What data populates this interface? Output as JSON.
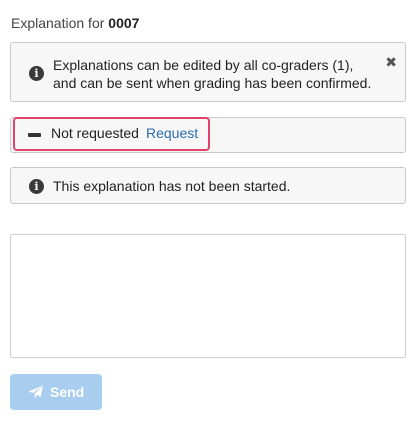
{
  "header": {
    "prefix": "Explanation for",
    "id": "0007"
  },
  "edit_notice": {
    "text": "Explanations can be edited by all co-graders (1), and can be sent when grading has been confirmed.",
    "icon": "info-icon",
    "close_icon": "close-icon",
    "close_glyph": "✖"
  },
  "request_status": {
    "icon": "dash-icon",
    "status": "Not requested",
    "action": "Request"
  },
  "progress_notice": {
    "text": "This explanation has not been started.",
    "icon": "info-icon"
  },
  "info_glyph": "i",
  "editor": {
    "value": ""
  },
  "send_button": {
    "label": "Send",
    "icon": "paper-plane-icon",
    "state": "disabled"
  },
  "colors": {
    "link": "#2a6bb0",
    "highlight_border": "#e0446c",
    "disabled_button": "#a9cdef",
    "notice_bg": "#f7f7f7"
  }
}
